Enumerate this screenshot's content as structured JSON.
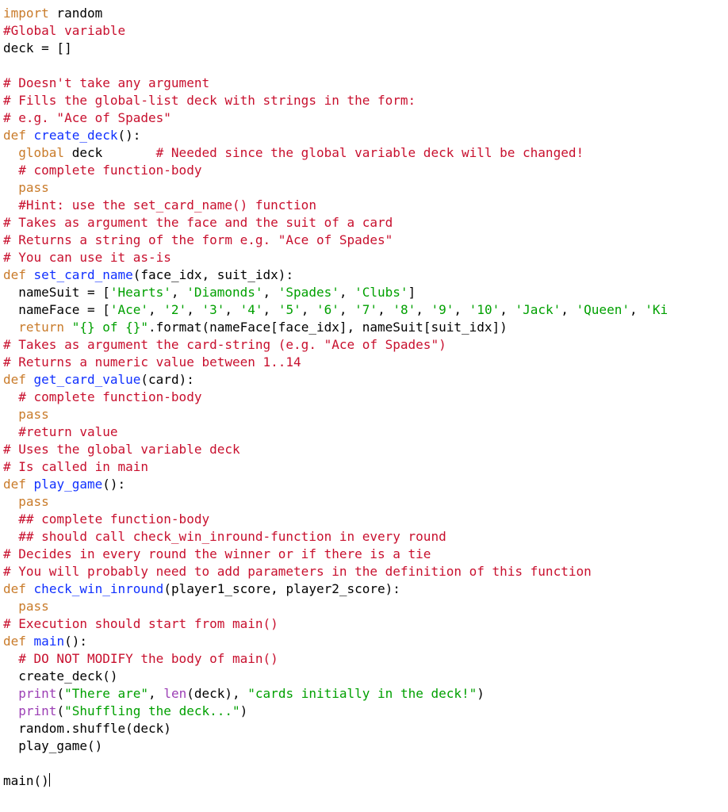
{
  "code": {
    "tokens": [
      [
        [
          "kw-orange",
          "import"
        ],
        [
          "ident",
          " random"
        ]
      ],
      [
        [
          "comment",
          "#Global variable"
        ]
      ],
      [
        [
          "ident",
          "deck = []"
        ]
      ],
      [
        [
          "ident",
          ""
        ]
      ],
      [
        [
          "comment",
          "# Doesn't take any argument"
        ]
      ],
      [
        [
          "comment",
          "# Fills the global-list deck with strings in the form:"
        ]
      ],
      [
        [
          "comment",
          "# e.g. \"Ace of Spades\""
        ]
      ],
      [
        [
          "kw-orange",
          "def"
        ],
        [
          "ident",
          " "
        ],
        [
          "fn-blue",
          "create_deck"
        ],
        [
          "ident",
          "():"
        ]
      ],
      [
        [
          "ident",
          "  "
        ],
        [
          "kw-orange",
          "global"
        ],
        [
          "ident",
          " deck       "
        ],
        [
          "comment",
          "# Needed since the global variable deck will be changed!"
        ]
      ],
      [
        [
          "ident",
          "  "
        ],
        [
          "comment",
          "# complete function-body"
        ]
      ],
      [
        [
          "ident",
          "  "
        ],
        [
          "kw-orange",
          "pass"
        ]
      ],
      [
        [
          "ident",
          "  "
        ],
        [
          "comment",
          "#Hint: use the set_card_name() function"
        ]
      ],
      [
        [
          "comment",
          "# Takes as argument the face and the suit of a card"
        ]
      ],
      [
        [
          "comment",
          "# Returns a string of the form e.g. \"Ace of Spades\""
        ]
      ],
      [
        [
          "comment",
          "# You can use it as-is"
        ]
      ],
      [
        [
          "kw-orange",
          "def"
        ],
        [
          "ident",
          " "
        ],
        [
          "fn-blue",
          "set_card_name"
        ],
        [
          "ident",
          "(face_idx, suit_idx):"
        ]
      ],
      [
        [
          "ident",
          "  nameSuit = ["
        ],
        [
          "string",
          "'Hearts'"
        ],
        [
          "ident",
          ", "
        ],
        [
          "string",
          "'Diamonds'"
        ],
        [
          "ident",
          ", "
        ],
        [
          "string",
          "'Spades'"
        ],
        [
          "ident",
          ", "
        ],
        [
          "string",
          "'Clubs'"
        ],
        [
          "ident",
          "]"
        ]
      ],
      [
        [
          "ident",
          "  nameFace = ["
        ],
        [
          "string",
          "'Ace'"
        ],
        [
          "ident",
          ", "
        ],
        [
          "string",
          "'2'"
        ],
        [
          "ident",
          ", "
        ],
        [
          "string",
          "'3'"
        ],
        [
          "ident",
          ", "
        ],
        [
          "string",
          "'4'"
        ],
        [
          "ident",
          ", "
        ],
        [
          "string",
          "'5'"
        ],
        [
          "ident",
          ", "
        ],
        [
          "string",
          "'6'"
        ],
        [
          "ident",
          ", "
        ],
        [
          "string",
          "'7'"
        ],
        [
          "ident",
          ", "
        ],
        [
          "string",
          "'8'"
        ],
        [
          "ident",
          ", "
        ],
        [
          "string",
          "'9'"
        ],
        [
          "ident",
          ", "
        ],
        [
          "string",
          "'10'"
        ],
        [
          "ident",
          ", "
        ],
        [
          "string",
          "'Jack'"
        ],
        [
          "ident",
          ", "
        ],
        [
          "string",
          "'Queen'"
        ],
        [
          "ident",
          ", "
        ],
        [
          "string",
          "'Ki"
        ]
      ],
      [
        [
          "ident",
          "  "
        ],
        [
          "kw-orange",
          "return"
        ],
        [
          "ident",
          " "
        ],
        [
          "string",
          "\"{} of {}\""
        ],
        [
          "ident",
          ".format(nameFace[face_idx], nameSuit[suit_idx])"
        ]
      ],
      [
        [
          "comment",
          "# Takes as argument the card-string (e.g. \"Ace of Spades\")"
        ]
      ],
      [
        [
          "comment",
          "# Returns a numeric value between 1..14"
        ]
      ],
      [
        [
          "kw-orange",
          "def"
        ],
        [
          "ident",
          " "
        ],
        [
          "fn-blue",
          "get_card_value"
        ],
        [
          "ident",
          "(card):"
        ]
      ],
      [
        [
          "ident",
          "  "
        ],
        [
          "comment",
          "# complete function-body"
        ]
      ],
      [
        [
          "ident",
          "  "
        ],
        [
          "kw-orange",
          "pass"
        ]
      ],
      [
        [
          "ident",
          "  "
        ],
        [
          "comment",
          "#return value"
        ]
      ],
      [
        [
          "comment",
          "# Uses the global variable deck"
        ]
      ],
      [
        [
          "comment",
          "# Is called in main"
        ]
      ],
      [
        [
          "kw-orange",
          "def"
        ],
        [
          "ident",
          " "
        ],
        [
          "fn-blue",
          "play_game"
        ],
        [
          "ident",
          "():"
        ]
      ],
      [
        [
          "ident",
          "  "
        ],
        [
          "kw-orange",
          "pass"
        ]
      ],
      [
        [
          "ident",
          "  "
        ],
        [
          "comment",
          "## complete function-body"
        ]
      ],
      [
        [
          "ident",
          "  "
        ],
        [
          "comment",
          "## should call check_win_inround-function in every round"
        ]
      ],
      [
        [
          "comment",
          "# Decides in every round the winner or if there is a tie"
        ]
      ],
      [
        [
          "comment",
          "# You will probably need to add parameters in the definition of this function"
        ]
      ],
      [
        [
          "kw-orange",
          "def"
        ],
        [
          "ident",
          " "
        ],
        [
          "fn-blue",
          "check_win_inround"
        ],
        [
          "ident",
          "(player1_score, player2_score):"
        ]
      ],
      [
        [
          "ident",
          "  "
        ],
        [
          "kw-orange",
          "pass"
        ]
      ],
      [
        [
          "comment",
          "# Execution should start from main()"
        ]
      ],
      [
        [
          "kw-orange",
          "def"
        ],
        [
          "ident",
          " "
        ],
        [
          "fn-blue",
          "main"
        ],
        [
          "ident",
          "():"
        ]
      ],
      [
        [
          "ident",
          "  "
        ],
        [
          "comment",
          "# DO NOT MODIFY the body of main()"
        ]
      ],
      [
        [
          "ident",
          "  create_deck()"
        ]
      ],
      [
        [
          "ident",
          "  "
        ],
        [
          "kw-purple",
          "print"
        ],
        [
          "ident",
          "("
        ],
        [
          "string",
          "\"There are\""
        ],
        [
          "ident",
          ", "
        ],
        [
          "kw-purple",
          "len"
        ],
        [
          "ident",
          "(deck), "
        ],
        [
          "string",
          "\"cards initially in the deck!\""
        ],
        [
          "ident",
          ")"
        ]
      ],
      [
        [
          "ident",
          "  "
        ],
        [
          "kw-purple",
          "print"
        ],
        [
          "ident",
          "("
        ],
        [
          "string",
          "\"Shuffling the deck...\""
        ],
        [
          "ident",
          ")"
        ]
      ],
      [
        [
          "ident",
          "  random.shuffle(deck)"
        ]
      ],
      [
        [
          "ident",
          "  play_game()"
        ]
      ],
      [
        [
          "ident",
          ""
        ]
      ],
      [
        [
          "ident",
          "main()"
        ],
        [
          "cursor",
          ""
        ]
      ]
    ]
  }
}
